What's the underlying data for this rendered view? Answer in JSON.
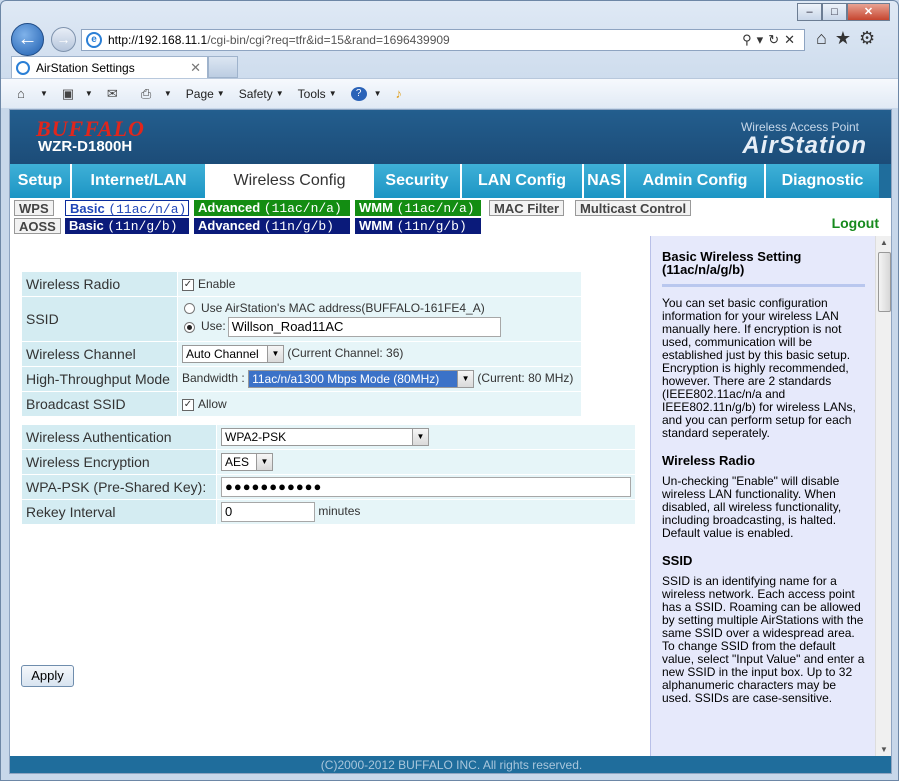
{
  "browser": {
    "url_host": "http://192.168.11.1",
    "url_path": "/cgi-bin/cgi?req=tfr&id=15&rand=1696439909",
    "tab_title": "AirStation Settings",
    "commands": [
      "Page",
      "Safety",
      "Tools"
    ]
  },
  "header": {
    "brand": "BUFFALO",
    "model": "WZR-D1800H",
    "tagline": "Wireless Access Point",
    "product": "AirStation"
  },
  "nav": {
    "tabs": [
      "Setup",
      "Internet/LAN",
      "Wireless Config",
      "Security",
      "LAN Config",
      "NAS",
      "Admin Config",
      "Diagnostic"
    ],
    "active": "Wireless Config"
  },
  "subnav": {
    "wps": "WPS",
    "aoss": "AOSS",
    "basic": "Basic",
    "advanced": "Advanced",
    "wmm": "WMM",
    "band_a": "(11ac/n/a)",
    "band_g": "(11n/g/b)",
    "mac_filter": "MAC Filter",
    "multicast": "Multicast Control",
    "logout": "Logout"
  },
  "form": {
    "radio_label": "Wireless Radio",
    "enable": "Enable",
    "ssid_label": "SSID",
    "ssid_opt_mac": "Use AirStation's MAC address(BUFFALO-161FE4_A)",
    "ssid_opt_use": "Use:",
    "ssid_value": "Willson_Road11AC",
    "channel_label": "Wireless Channel",
    "channel_value": "Auto Channel",
    "current_channel": "(Current Channel: 36)",
    "ht_label": "High-Throughput Mode",
    "bandwidth_label": "Bandwidth :",
    "bandwidth_value": "11ac/n/a1300 Mbps Mode (80MHz)",
    "current_bw": "(Current: 80 MHz)",
    "broadcast_label": "Broadcast SSID",
    "allow": "Allow",
    "auth_label": "Wireless Authentication",
    "auth_value": "WPA2-PSK",
    "enc_label": "Wireless Encryption",
    "enc_value": "AES",
    "psk_label": "WPA-PSK (Pre-Shared Key):",
    "psk_value": "●●●●●●●●●●●",
    "rekey_label": "Rekey Interval",
    "rekey_value": "0",
    "rekey_unit": "minutes",
    "apply": "Apply"
  },
  "help": {
    "title": "Basic Wireless Setting (11ac/n/a/g/b)",
    "intro": "You can set basic configuration information for your wireless LAN manually here. If encryption is not used, communication will be established just by this basic setup. Encryption is highly recommended, however. There are 2 standards (IEEE802.11ac/n/a and IEEE802.11n/g/b) for wireless LANs, and you can perform setup for each standard seperately.",
    "radio_title": "Wireless Radio",
    "radio_text": "Un-checking \"Enable\" will disable wireless LAN functionality. When disabled, all wireless functionality, including broadcasting, is halted. Default value is enabled.",
    "ssid_title": "SSID",
    "ssid_text": "SSID is an identifying name for a wireless network. Each access point has a SSID. Roaming can be allowed by setting multiple AirStations with the same SSID over a widespread area. To change SSID from the default value, select \"Input Value\" and enter a new SSID in the input box. Up to 32 alphanumeric characters may be used. SSIDs are case-sensitive."
  },
  "footer": "(C)2000-2012 BUFFALO INC. All rights reserved."
}
